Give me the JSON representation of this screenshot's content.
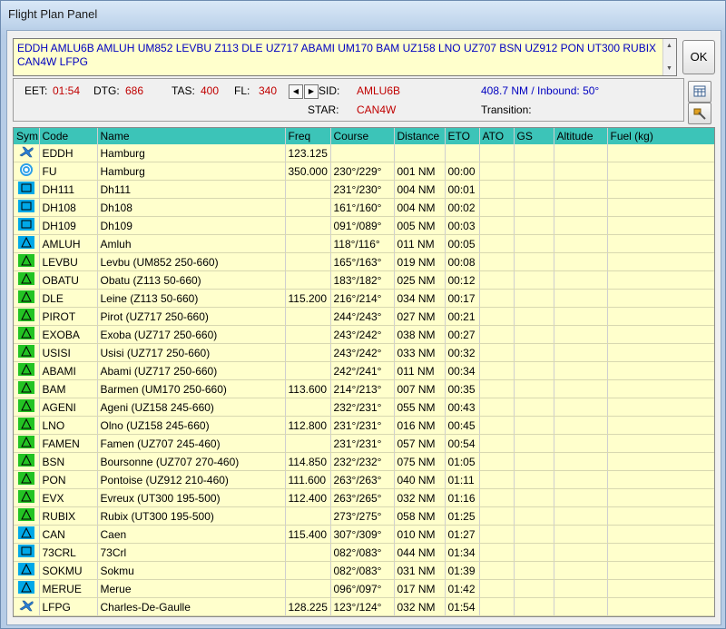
{
  "window": {
    "title": "Flight Plan Panel"
  },
  "route": {
    "text": "EDDH AMLU6B AMLUH UM852 LEVBU Z113 DLE UZ717 ABAMI UM170 BAM UZ158 LNO UZ707 BSN UZ912 PON UT300 RUBIX CAN4W LFPG"
  },
  "ok_label": "OK",
  "info": {
    "eet_label": "EET:",
    "eet_value": "01:54",
    "dtg_label": "DTG:",
    "dtg_value": "686",
    "tas_label": "TAS:",
    "tas_value": "400",
    "fl_label": "FL:",
    "fl_value": "340",
    "sid_label": "SID:",
    "sid_value": "AMLU6B",
    "star_label": "STAR:",
    "star_value": "CAN4W",
    "distance_inbound": "408.7 NM / Inbound: 50°",
    "transition_label": "Transition:"
  },
  "table": {
    "headers": [
      "Sym",
      "Code",
      "Name",
      "Freq",
      "Course",
      "Distance",
      "ETO",
      "ATO",
      "GS",
      "Altitude",
      "Fuel (kg)"
    ],
    "rows": [
      {
        "sym": "plane",
        "code": "EDDH",
        "name": "Hamburg",
        "freq": "123.125",
        "course": "",
        "distance": "",
        "eto": ""
      },
      {
        "sym": "vor",
        "code": "FU",
        "name": "Hamburg",
        "freq": "350.000",
        "course": "230°/229°",
        "distance": "001 NM",
        "eto": "00:00"
      },
      {
        "sym": "square",
        "code": "DH111",
        "name": "Dh111",
        "freq": "",
        "course": "231°/230°",
        "distance": "004 NM",
        "eto": "00:01"
      },
      {
        "sym": "square",
        "code": "DH108",
        "name": "Dh108",
        "freq": "",
        "course": "161°/160°",
        "distance": "004 NM",
        "eto": "00:02"
      },
      {
        "sym": "square",
        "code": "DH109",
        "name": "Dh109",
        "freq": "",
        "course": "091°/089°",
        "distance": "005 NM",
        "eto": "00:03"
      },
      {
        "sym": "tri-blue",
        "code": "AMLUH",
        "name": "Amluh",
        "freq": "",
        "course": "118°/116°",
        "distance": "011 NM",
        "eto": "00:05"
      },
      {
        "sym": "tri-green",
        "code": "LEVBU",
        "name": "Levbu (UM852 250-660)",
        "freq": "",
        "course": "165°/163°",
        "distance": "019 NM",
        "eto": "00:08"
      },
      {
        "sym": "tri-green",
        "code": "OBATU",
        "name": "Obatu (Z113 50-660)",
        "freq": "",
        "course": "183°/182°",
        "distance": "025 NM",
        "eto": "00:12"
      },
      {
        "sym": "tri-green",
        "code": "DLE",
        "name": "Leine (Z113 50-660)",
        "freq": "115.200",
        "course": "216°/214°",
        "distance": "034 NM",
        "eto": "00:17"
      },
      {
        "sym": "tri-green",
        "code": "PIROT",
        "name": "Pirot (UZ717 250-660)",
        "freq": "",
        "course": "244°/243°",
        "distance": "027 NM",
        "eto": "00:21"
      },
      {
        "sym": "tri-green",
        "code": "EXOBA",
        "name": "Exoba (UZ717 250-660)",
        "freq": "",
        "course": "243°/242°",
        "distance": "038 NM",
        "eto": "00:27"
      },
      {
        "sym": "tri-green",
        "code": "USISI",
        "name": "Usisi (UZ717 250-660)",
        "freq": "",
        "course": "243°/242°",
        "distance": "033 NM",
        "eto": "00:32"
      },
      {
        "sym": "tri-green",
        "code": "ABAMI",
        "name": "Abami (UZ717 250-660)",
        "freq": "",
        "course": "242°/241°",
        "distance": "011 NM",
        "eto": "00:34"
      },
      {
        "sym": "tri-green",
        "code": "BAM",
        "name": "Barmen (UM170 250-660)",
        "freq": "113.600",
        "course": "214°/213°",
        "distance": "007 NM",
        "eto": "00:35"
      },
      {
        "sym": "tri-green",
        "code": "AGENI",
        "name": "Ageni (UZ158 245-660)",
        "freq": "",
        "course": "232°/231°",
        "distance": "055 NM",
        "eto": "00:43"
      },
      {
        "sym": "tri-green",
        "code": "LNO",
        "name": "Olno (UZ158 245-660)",
        "freq": "112.800",
        "course": "231°/231°",
        "distance": "016 NM",
        "eto": "00:45"
      },
      {
        "sym": "tri-green",
        "code": "FAMEN",
        "name": "Famen (UZ707 245-460)",
        "freq": "",
        "course": "231°/231°",
        "distance": "057 NM",
        "eto": "00:54"
      },
      {
        "sym": "tri-green",
        "code": "BSN",
        "name": "Boursonne (UZ707 270-460)",
        "freq": "114.850",
        "course": "232°/232°",
        "distance": "075 NM",
        "eto": "01:05"
      },
      {
        "sym": "tri-green",
        "code": "PON",
        "name": "Pontoise (UZ912 210-460)",
        "freq": "111.600",
        "course": "263°/263°",
        "distance": "040 NM",
        "eto": "01:11"
      },
      {
        "sym": "tri-green",
        "code": "EVX",
        "name": "Evreux (UT300 195-500)",
        "freq": "112.400",
        "course": "263°/265°",
        "distance": "032 NM",
        "eto": "01:16"
      },
      {
        "sym": "tri-green",
        "code": "RUBIX",
        "name": "Rubix (UT300 195-500)",
        "freq": "",
        "course": "273°/275°",
        "distance": "058 NM",
        "eto": "01:25"
      },
      {
        "sym": "tri-blue",
        "code": "CAN",
        "name": "Caen",
        "freq": "115.400",
        "course": "307°/309°",
        "distance": "010 NM",
        "eto": "01:27"
      },
      {
        "sym": "square",
        "code": "73CRL",
        "name": "73Crl",
        "freq": "",
        "course": "082°/083°",
        "distance": "044 NM",
        "eto": "01:34"
      },
      {
        "sym": "tri-blue",
        "code": "SOKMU",
        "name": "Sokmu",
        "freq": "",
        "course": "082°/083°",
        "distance": "031 NM",
        "eto": "01:39"
      },
      {
        "sym": "tri-blue",
        "code": "MERUE",
        "name": "Merue",
        "freq": "",
        "course": "096°/097°",
        "distance": "017 NM",
        "eto": "01:42"
      },
      {
        "sym": "plane-land",
        "code": "LFPG",
        "name": "Charles-De-Gaulle",
        "freq": "128.225",
        "course": "123°/124°",
        "distance": "032 NM",
        "eto": "01:54"
      }
    ]
  },
  "colors": {
    "header": "#3cc4b8",
    "row_bg": "#ffffcc",
    "route_text": "#0000c0",
    "value_red": "#c00000"
  }
}
